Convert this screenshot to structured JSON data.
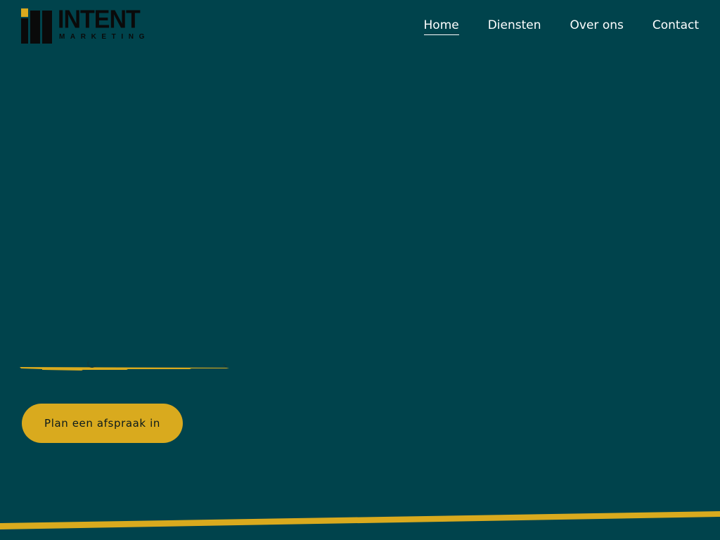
{
  "brand": {
    "name": "INTENT",
    "tagline": "MARKETING",
    "colors": {
      "background": "#00434c",
      "accent": "#d9aa1e",
      "text": "#ffffff",
      "logo_dark": "#0a0a0a"
    }
  },
  "nav": {
    "items": [
      {
        "label": "Home",
        "active": true
      },
      {
        "label": "Diensten",
        "active": false
      },
      {
        "label": "Over ons",
        "active": false
      },
      {
        "label": "Contact",
        "active": false
      }
    ]
  },
  "hero": {
    "cta_label": "Plan een afspraak in"
  }
}
